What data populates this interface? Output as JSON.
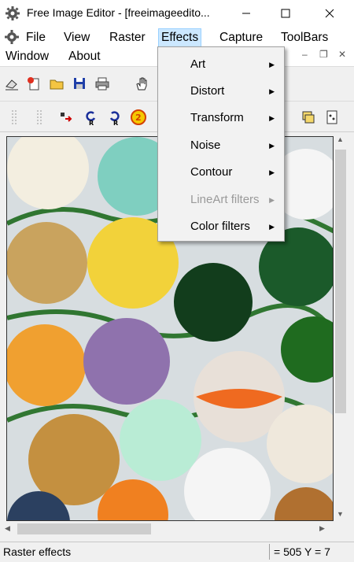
{
  "window": {
    "title": "Free Image Editor - [freeimageedito...",
    "minimize_label": "—",
    "maximize_label": "☐",
    "close_label": "✕"
  },
  "menubar": {
    "items": [
      {
        "label": "File"
      },
      {
        "label": "View"
      },
      {
        "label": "Raster"
      },
      {
        "label": "Effects"
      },
      {
        "label": "Capture"
      },
      {
        "label": "ToolBars"
      },
      {
        "label": "Window"
      },
      {
        "label": "About"
      }
    ],
    "active_index": 3,
    "mdi_controls": [
      "–",
      "❐",
      "✕"
    ]
  },
  "effects_menu": {
    "items": [
      {
        "label": "Art",
        "enabled": true
      },
      {
        "label": "Distort",
        "enabled": true
      },
      {
        "label": "Transform",
        "enabled": true
      },
      {
        "label": "Noise",
        "enabled": true
      },
      {
        "label": "Contour",
        "enabled": true
      },
      {
        "label": "LineArt filters",
        "enabled": false
      },
      {
        "label": "Color filters",
        "enabled": true
      }
    ]
  },
  "toolbar": {
    "zoom_value": "%",
    "row1_icons": [
      "eraser-icon",
      "new-image-icon",
      "open-folder-icon",
      "save-icon",
      "print-icon",
      "hand-pan-icon"
    ],
    "row2_icons": [
      "grip-icon",
      "grip-icon",
      "move-right-icon",
      "rotate-left-icon",
      "rotate-right-icon",
      "zoom-icon"
    ]
  },
  "statusbar": {
    "left_text": "Raster effects",
    "right_text": "= 505  Y = 7"
  },
  "colors": {
    "menu_highlight": "#cce8ff",
    "menu_highlight_border": "#99d1ff",
    "chrome_bg": "#f0f0f0",
    "contour_green": "#1f6b1f"
  }
}
